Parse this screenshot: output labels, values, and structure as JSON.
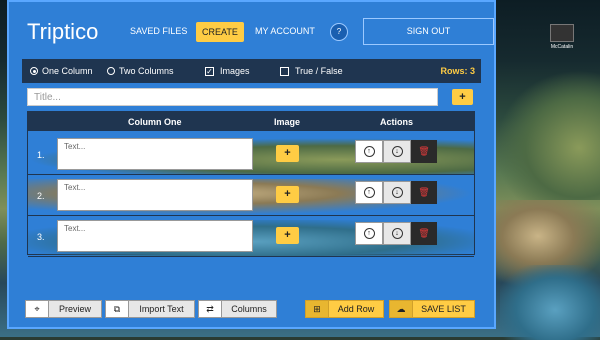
{
  "desktop": {
    "icon_label": "McCatalin"
  },
  "app": {
    "logo": "Triptico",
    "nav": {
      "saved": "SAVED FILES",
      "create": "CREATE",
      "account": "MY ACCOUNT",
      "help": "?",
      "signout": "SIGN OUT"
    },
    "options": {
      "one_column": "One Column",
      "two_columns": "Two Columns",
      "images": "Images",
      "true_false": "True / False",
      "rows_label": "Rows: 3"
    },
    "title_placeholder": "Title...",
    "table": {
      "headers": [
        "Column One",
        "Image",
        "Actions"
      ],
      "rows": [
        {
          "num": "1.",
          "placeholder": "Text..."
        },
        {
          "num": "2.",
          "placeholder": "Text..."
        },
        {
          "num": "3.",
          "placeholder": "Text..."
        }
      ]
    },
    "bottom": {
      "preview": "Preview",
      "import": "Import Text",
      "columns": "Columns",
      "add_row": "Add Row",
      "save": "SAVE LIST"
    }
  },
  "colors": {
    "accent": "#2f7fd6",
    "dark": "#1f3550",
    "yellow": "#ffcc44",
    "danger": "#e23b3b"
  },
  "icons": [
    "binoculars-icon",
    "copy-icon",
    "swap-icon",
    "plus-square-icon",
    "cloud-upload-icon",
    "arrow-up-icon",
    "arrow-down-icon",
    "trash-icon",
    "plus-icon"
  ]
}
